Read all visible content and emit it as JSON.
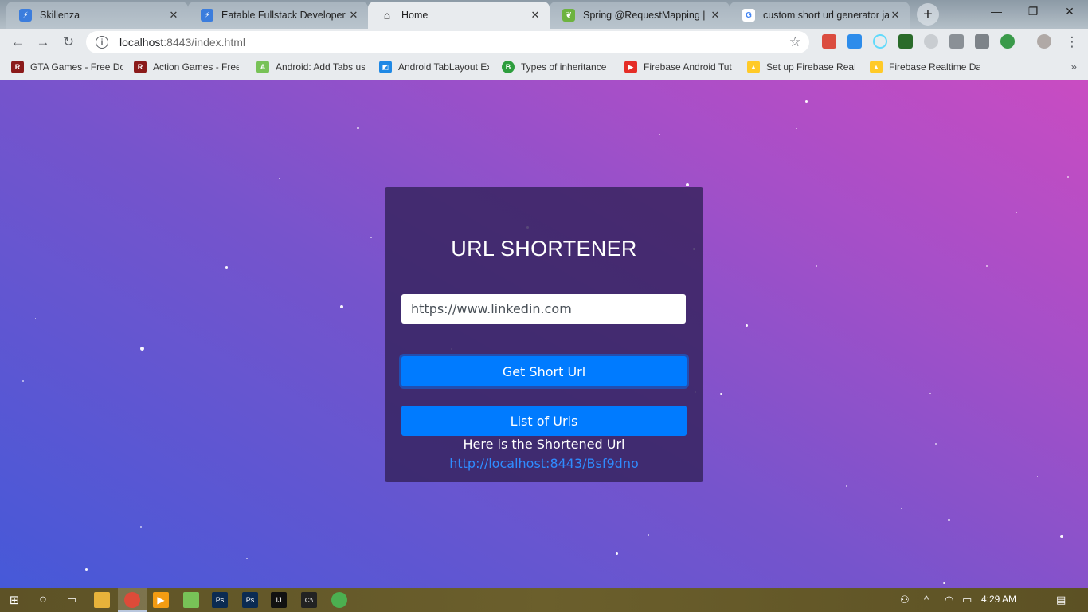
{
  "browser": {
    "tabs": [
      {
        "title": "Skillenza",
        "active": false
      },
      {
        "title": "Eatable Fullstack Developer",
        "active": false
      },
      {
        "title": "Home",
        "active": true
      },
      {
        "title": "Spring @RequestMapping | Ba",
        "active": false
      },
      {
        "title": "custom short url generator jav",
        "active": false
      }
    ],
    "address": {
      "host": "localhost",
      "path": ":8443/index.html"
    },
    "bookmarks": [
      {
        "label": "GTA Games - Free Do"
      },
      {
        "label": "Action Games - Free"
      },
      {
        "label": "Android: Add Tabs us"
      },
      {
        "label": "Android TabLayout Ex"
      },
      {
        "label": "Types of inheritance"
      },
      {
        "label": "Firebase Android Tut"
      },
      {
        "label": "Set up Firebase Realt"
      },
      {
        "label": "Firebase Realtime Dat"
      }
    ],
    "more_bookmarks": "»"
  },
  "app": {
    "title": "URL SHORTENER",
    "input_value": "https://www.linkedin.com",
    "get_button": "Get Short Url",
    "list_button": "List of Urls",
    "result_label": "Here is the Shortened Url",
    "result_link": "http://localhost:8443/Bsf9dno"
  },
  "taskbar": {
    "time": "4:29 AM"
  },
  "colors": {
    "primary_button": "#007bff",
    "link": "#2f8cff"
  }
}
